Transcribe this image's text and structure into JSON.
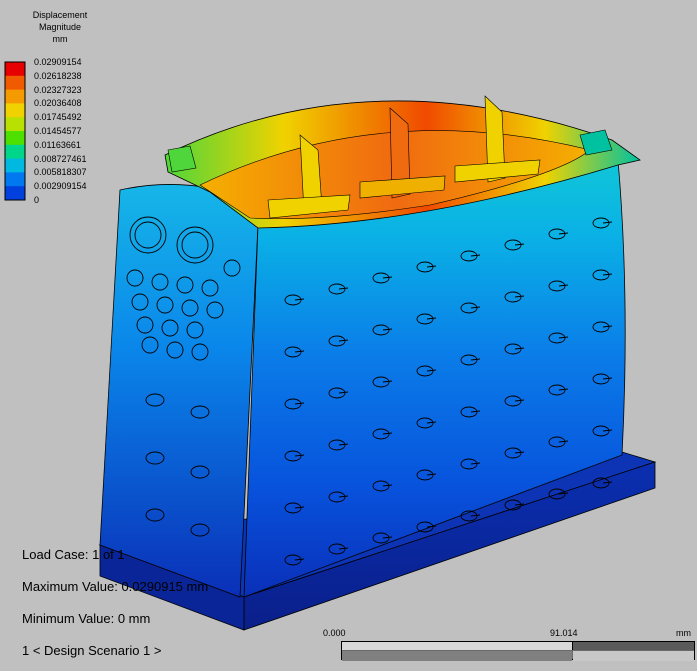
{
  "legend": {
    "title_lines": [
      "Displacement",
      "Magnitude",
      "mm"
    ],
    "values": [
      "0.02909154",
      "0.02618238",
      "0.02327323",
      "0.02036408",
      "0.01745492",
      "0.01454577",
      "0.01163661",
      "0.008727461",
      "0.005818307",
      "0.002909154",
      "0"
    ],
    "colors": [
      "#e60000",
      "#f05a00",
      "#f59a00",
      "#f0d200",
      "#b8e000",
      "#4ee000",
      "#00d68a",
      "#00b8e0",
      "#0078f0",
      "#0040dc",
      "#0000b4"
    ]
  },
  "info": {
    "load_case": "Load Case: 1 of 1",
    "max_value": "Maximum Value: 0.0290915 mm",
    "min_value": "Minimum Value: 0 mm",
    "scenario": "1 < Design Scenario 1 >"
  },
  "scale": {
    "start": "0.000",
    "mid": "91.014",
    "unit": "mm"
  }
}
